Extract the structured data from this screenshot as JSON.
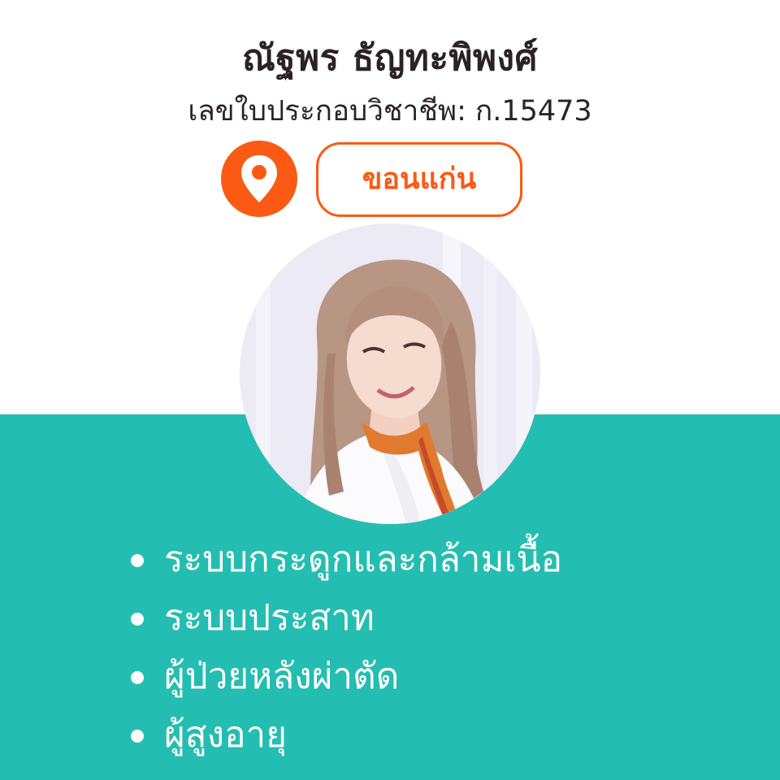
{
  "profile": {
    "name": "ณัฐพร ธัญทะพิพงศ์",
    "license": "เลขใบประกอบวิชาชีพ: ก.15473"
  },
  "location": {
    "icon": "map-pin-icon",
    "label": "ขอนแก่น"
  },
  "specialties": [
    "ระบบกระดูกและกล้ามเนื้อ",
    "ระบบประสาท",
    "ผู้ป่วยหลังผ่าตัด",
    "ผู้สูงอายุ"
  ],
  "colors": {
    "accent_orange": "#fa5a14",
    "teal_background": "#24bdb1",
    "title_text": "#2a2224",
    "white": "#ffffff"
  }
}
